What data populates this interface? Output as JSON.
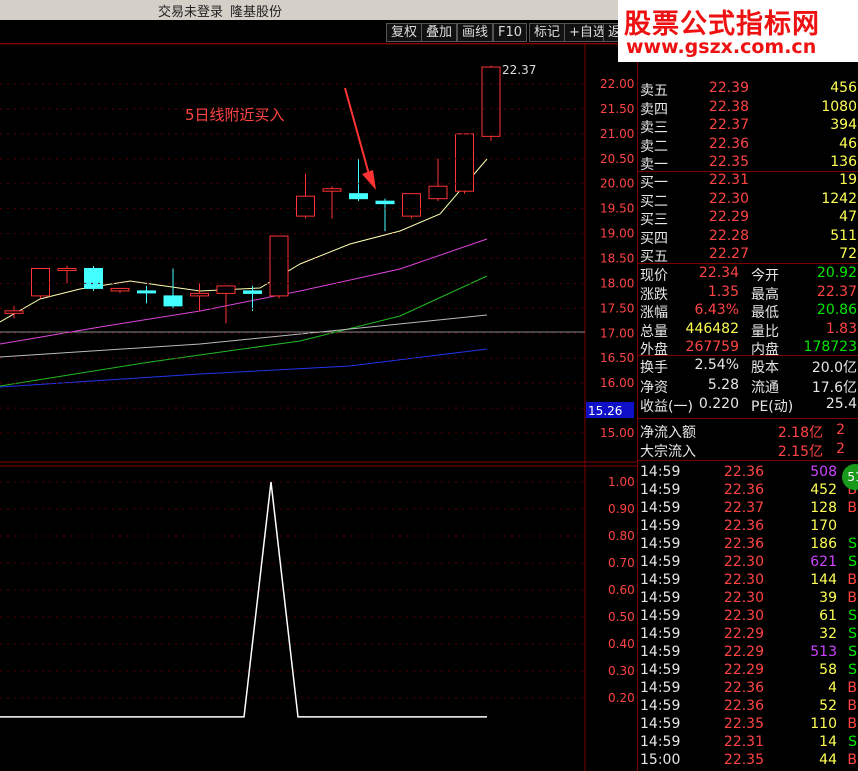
{
  "titlebar": {
    "trade_status": "交易未登录",
    "stock_name": "隆基股份"
  },
  "toolbar": {
    "buttons": [
      "复权",
      "叠加",
      "画线",
      "F10",
      "标记",
      "+自选",
      "返回"
    ]
  },
  "watermark": {
    "line1": "股票公式指标网",
    "line2": "www.gszx.com.cn"
  },
  "chart": {
    "annotation": "5日线附近买入",
    "high_label": "22.37",
    "price_axis": [
      "22.00",
      "21.50",
      "21.00",
      "20.50",
      "20.00",
      "19.50",
      "19.00",
      "18.50",
      "18.00",
      "17.50",
      "17.00",
      "16.50",
      "16.00",
      "15.50",
      "15.00"
    ],
    "current_marker": "15.26",
    "indicator_axis": [
      "1.00",
      "0.90",
      "0.80",
      "0.70",
      "0.60",
      "0.50",
      "0.40",
      "0.30",
      "0.20"
    ],
    "candles": [
      {
        "o": 17.4,
        "h": 17.55,
        "l": 17.3,
        "c": 17.45,
        "up": true
      },
      {
        "o": 17.75,
        "h": 18.3,
        "l": 17.7,
        "c": 18.3,
        "up": true
      },
      {
        "o": 18.3,
        "h": 18.35,
        "l": 18.0,
        "c": 18.3,
        "up": true
      },
      {
        "o": 18.3,
        "h": 18.35,
        "l": 17.85,
        "c": 17.9,
        "up": false
      },
      {
        "o": 17.85,
        "h": 17.9,
        "l": 17.8,
        "c": 17.9,
        "up": true
      },
      {
        "o": 17.85,
        "h": 17.95,
        "l": 17.6,
        "c": 17.85,
        "up": false
      },
      {
        "o": 17.75,
        "h": 18.3,
        "l": 17.5,
        "c": 17.55,
        "up": false
      },
      {
        "o": 17.75,
        "h": 18.0,
        "l": 17.45,
        "c": 17.8,
        "up": true
      },
      {
        "o": 17.8,
        "h": 17.95,
        "l": 17.2,
        "c": 17.95,
        "up": true
      },
      {
        "o": 17.85,
        "h": 17.95,
        "l": 17.45,
        "c": 17.8,
        "up": false
      },
      {
        "o": 17.75,
        "h": 18.95,
        "l": 17.7,
        "c": 18.95,
        "up": true
      },
      {
        "o": 19.35,
        "h": 20.2,
        "l": 19.3,
        "c": 19.75,
        "up": true
      },
      {
        "o": 19.85,
        "h": 19.95,
        "l": 19.3,
        "c": 19.9,
        "up": true
      },
      {
        "o": 19.8,
        "h": 20.5,
        "l": 19.65,
        "c": 19.7,
        "up": false
      },
      {
        "o": 19.65,
        "h": 19.7,
        "l": 19.05,
        "c": 19.6,
        "up": false
      },
      {
        "o": 19.35,
        "h": 19.8,
        "l": 19.3,
        "c": 19.8,
        "up": true
      },
      {
        "o": 19.7,
        "h": 20.5,
        "l": 19.65,
        "c": 19.95,
        "up": true
      },
      {
        "o": 19.85,
        "h": 21.0,
        "l": 19.8,
        "c": 21.0,
        "up": true
      },
      {
        "o": 20.95,
        "h": 22.37,
        "l": 20.86,
        "c": 22.34,
        "up": true
      }
    ]
  },
  "quote": {
    "asks": [
      {
        "label": "卖五",
        "price": "22.39",
        "vol": "456"
      },
      {
        "label": "卖四",
        "price": "22.38",
        "vol": "1080"
      },
      {
        "label": "卖三",
        "price": "22.37",
        "vol": "394"
      },
      {
        "label": "卖二",
        "price": "22.36",
        "vol": "46"
      },
      {
        "label": "卖一",
        "price": "22.35",
        "vol": "136"
      }
    ],
    "bids": [
      {
        "label": "买一",
        "price": "22.31",
        "vol": "19"
      },
      {
        "label": "买二",
        "price": "22.30",
        "vol": "1242"
      },
      {
        "label": "买三",
        "price": "22.29",
        "vol": "47"
      },
      {
        "label": "买四",
        "price": "22.28",
        "vol": "511"
      },
      {
        "label": "买五",
        "price": "22.27",
        "vol": "72"
      }
    ],
    "stats": [
      {
        "l1": "现价",
        "v1": "22.34",
        "c1": "red",
        "l2": "今开",
        "v2": "20.92",
        "c2": "grn"
      },
      {
        "l1": "涨跌",
        "v1": "1.35",
        "c1": "red",
        "l2": "最高",
        "v2": "22.37",
        "c2": "red"
      },
      {
        "l1": "涨幅",
        "v1": "6.43%",
        "c1": "red",
        "l2": "最低",
        "v2": "20.86",
        "c2": "grn"
      },
      {
        "l1": "总量",
        "v1": "446482",
        "c1": "yel",
        "l2": "量比",
        "v2": "1.83",
        "c2": "red"
      },
      {
        "l1": "外盘",
        "v1": "267759",
        "c1": "red",
        "l2": "内盘",
        "v2": "178723",
        "c2": "grn"
      },
      {
        "l1": "换手",
        "v1": "2.54%",
        "c1": "wht",
        "l2": "股本",
        "v2": "20.0亿",
        "c2": "wht"
      },
      {
        "l1": "净资",
        "v1": "5.28",
        "c1": "wht",
        "l2": "流通",
        "v2": "17.6亿",
        "c2": "wht"
      },
      {
        "l1": "收益(一)",
        "v1": "0.220",
        "c1": "wht",
        "l2": "PE(动)",
        "v2": "25.4",
        "c2": "wht"
      }
    ],
    "flow": [
      {
        "label": "净流入额",
        "value": "2.18亿",
        "extra": "2"
      },
      {
        "label": "大宗流入",
        "value": "2.15亿",
        "extra": "2"
      }
    ],
    "badge": "51"
  },
  "ticks": [
    {
      "t": "14:59",
      "p": "22.36",
      "v": "508",
      "vc": "mag",
      "bs": "B"
    },
    {
      "t": "14:59",
      "p": "22.36",
      "v": "452",
      "vc": "yel",
      "bs": "B"
    },
    {
      "t": "14:59",
      "p": "22.37",
      "v": "128",
      "vc": "yel",
      "bs": "B"
    },
    {
      "t": "14:59",
      "p": "22.36",
      "v": "170",
      "vc": "yel",
      "bs": ""
    },
    {
      "t": "14:59",
      "p": "22.36",
      "v": "186",
      "vc": "yel",
      "bs": "S"
    },
    {
      "t": "14:59",
      "p": "22.30",
      "v": "621",
      "vc": "mag",
      "bs": "S"
    },
    {
      "t": "14:59",
      "p": "22.30",
      "v": "144",
      "vc": "yel",
      "bs": "B"
    },
    {
      "t": "14:59",
      "p": "22.30",
      "v": "39",
      "vc": "yel",
      "bs": "B"
    },
    {
      "t": "14:59",
      "p": "22.30",
      "v": "61",
      "vc": "yel",
      "bs": "S"
    },
    {
      "t": "14:59",
      "p": "22.29",
      "v": "32",
      "vc": "yel",
      "bs": "S"
    },
    {
      "t": "14:59",
      "p": "22.29",
      "v": "513",
      "vc": "mag",
      "bs": "S"
    },
    {
      "t": "14:59",
      "p": "22.29",
      "v": "58",
      "vc": "yel",
      "bs": "S"
    },
    {
      "t": "14:59",
      "p": "22.36",
      "v": "4",
      "vc": "yel",
      "bs": "B"
    },
    {
      "t": "14:59",
      "p": "22.36",
      "v": "52",
      "vc": "yel",
      "bs": "B"
    },
    {
      "t": "14:59",
      "p": "22.35",
      "v": "110",
      "vc": "yel",
      "bs": "B"
    },
    {
      "t": "14:59",
      "p": "22.31",
      "v": "14",
      "vc": "yel",
      "bs": "S"
    },
    {
      "t": "15:00",
      "p": "22.35",
      "v": "44",
      "vc": "yel",
      "bs": "B"
    }
  ]
}
